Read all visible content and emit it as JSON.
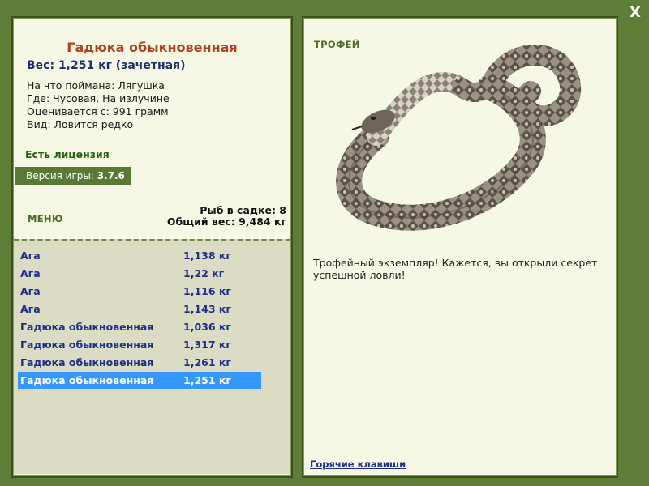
{
  "close": {
    "label": "X"
  },
  "left": {
    "title": "Гадюка обыкновенная",
    "weight_line": "Вес: 1,251 кг (зачетная)",
    "info": [
      "На что поймана: Лягушка",
      "Где: Чусовая, На излучине",
      "Оценивается с: 991 грамм",
      "Вид: Ловится редко"
    ],
    "license": "Есть лицензия",
    "version_label": "Версия игры: ",
    "version_value": "3.7.6",
    "menu_label": "МЕНЮ",
    "fish_in_keepnet": "Рыб в садке: 8",
    "total_weight": "Общий вес: 9,484 кг"
  },
  "catch_list": [
    {
      "name": "Ага",
      "weight": "1,138 кг",
      "selected": false
    },
    {
      "name": "Ага",
      "weight": "1,22 кг",
      "selected": false
    },
    {
      "name": "Ага",
      "weight": "1,116 кг",
      "selected": false
    },
    {
      "name": "Ага",
      "weight": "1,143 кг",
      "selected": false
    },
    {
      "name": "Гадюка обыкновенная",
      "weight": "1,036 кг",
      "selected": false
    },
    {
      "name": "Гадюка обыкновенная",
      "weight": "1,317 кг",
      "selected": false
    },
    {
      "name": "Гадюка обыкновенная",
      "weight": "1,261 кг",
      "selected": false
    },
    {
      "name": "Гадюка обыкновенная",
      "weight": "1,251 кг",
      "selected": true
    }
  ],
  "right": {
    "trophy_label": "ТРОФЕЙ",
    "trophy_text": "Трофейный экземпляр! Кажется, вы открыли секрет успешной ловли!",
    "hotkeys": "Горячие клавиши",
    "image_icon": "snake-icon"
  },
  "colors": {
    "background": "#5e7e38",
    "panel": "#f7f7e5",
    "title": "#b0411d",
    "selected_row": "#3399ff",
    "link": "#1c2f8a"
  }
}
